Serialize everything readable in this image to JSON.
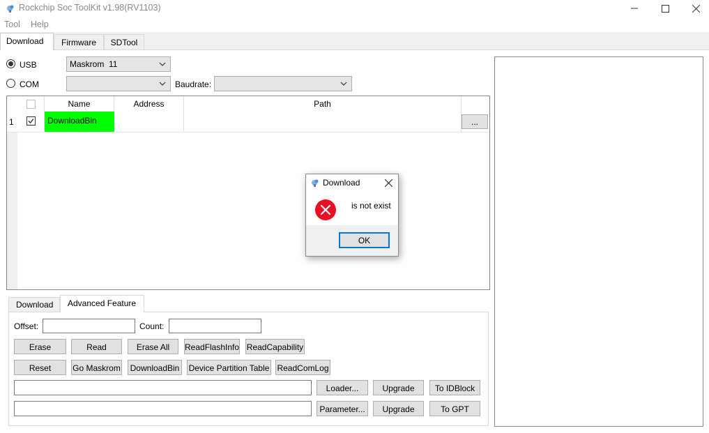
{
  "window": {
    "title": "Rockchip Soc ToolKit v1.98(RV1103)",
    "controls": [
      "minimize",
      "maximize",
      "close"
    ]
  },
  "menu": {
    "items": [
      "Tool",
      "Help"
    ]
  },
  "main_tabs": {
    "items": [
      "Download",
      "Firmware",
      "SDTool"
    ],
    "active": "Download"
  },
  "connection": {
    "usb_label": "USB",
    "usb_selected": true,
    "usb_device": "Maskrom  11",
    "com_label": "COM",
    "com_selected": false,
    "com_port": "",
    "baudrate_label": "Baudrate:",
    "baudrate_value": ""
  },
  "grid": {
    "headers": {
      "name": "Name",
      "address": "Address",
      "path": "Path"
    },
    "rows": [
      {
        "index": "1",
        "checked": true,
        "name": "DownloadBin",
        "address": "",
        "path": "",
        "browse": "..."
      }
    ],
    "name_highlight": "#00ff00"
  },
  "bottom_tabs": {
    "items": [
      "Download",
      "Advanced Feature"
    ],
    "active": "Advanced Feature"
  },
  "advanced": {
    "offset_label": "Offset:",
    "offset_value": "",
    "count_label": "Count:",
    "count_value": "",
    "row1": [
      "Erase",
      "Read",
      "Erase All",
      "ReadFlashInfo",
      "ReadCapability"
    ],
    "row2": [
      "Reset",
      "Go Maskrom",
      "DownloadBin",
      "Device Partition Table",
      "ReadComLog"
    ],
    "loader_path": "",
    "loader_button": "Loader...",
    "loader_upgrade": "Upgrade",
    "to_idblock": "To IDBlock",
    "parameter_path": "",
    "parameter_button": "Parameter...",
    "parameter_upgrade": "Upgrade",
    "to_gpt": "To GPT"
  },
  "dialog": {
    "title": "Download",
    "message": "is not exist",
    "ok_label": "OK",
    "icon": "error-icon",
    "error_color": "#e81123"
  }
}
